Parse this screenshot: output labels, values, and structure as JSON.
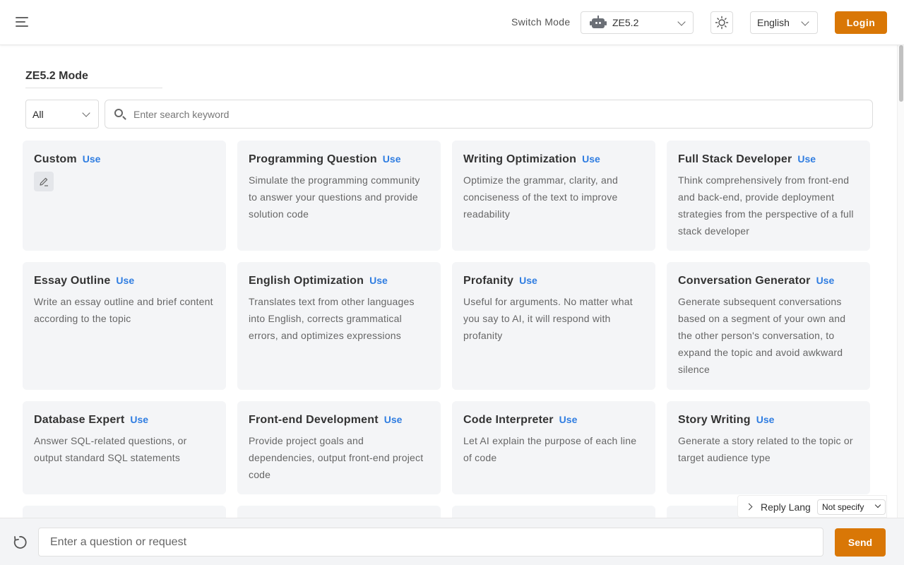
{
  "header": {
    "switch_mode_label": "Switch Mode",
    "mode_value": "ZE5.2",
    "language_value": "English",
    "login_label": "Login",
    "accent_color": "#d97706"
  },
  "main": {
    "title": "ZE5.2 Mode",
    "filter_value": "All",
    "search_placeholder": "Enter search keyword"
  },
  "cards": [
    {
      "title": "Custom",
      "use": "Use",
      "desc": "",
      "icon": "edit-icon"
    },
    {
      "title": "Programming Question",
      "use": "Use",
      "desc": "Simulate the programming community to answer your questions and provide solution code"
    },
    {
      "title": "Writing Optimization",
      "use": "Use",
      "desc": "Optimize the grammar, clarity, and conciseness of the text to improve readability"
    },
    {
      "title": "Full Stack Developer",
      "use": "Use",
      "desc": "Think comprehensively from front-end and back-end, provide deployment strategies from the perspective of a full stack developer"
    },
    {
      "title": "Essay Outline",
      "use": "Use",
      "desc": "Write an essay outline and brief content according to the topic"
    },
    {
      "title": "English Optimization",
      "use": "Use",
      "desc": "Translates text from other languages into English, corrects grammatical errors, and optimizes expressions"
    },
    {
      "title": "Profanity",
      "use": "Use",
      "desc": "Useful for arguments. No matter what you say to AI, it will respond with profanity"
    },
    {
      "title": "Conversation Generator",
      "use": "Use",
      "desc": "Generate subsequent conversations based on a segment of your own and the other person's conversation, to expand the topic and avoid awkward silence"
    },
    {
      "title": "Database Expert",
      "use": "Use",
      "desc": "Answer SQL-related questions, or output standard SQL statements"
    },
    {
      "title": "Front-end Development",
      "use": "Use",
      "desc": "Provide project goals and dependencies, output front-end project code"
    },
    {
      "title": "Code Interpreter",
      "use": "Use",
      "desc": "Let AI explain the purpose of each line of code"
    },
    {
      "title": "Story Writing",
      "use": "Use",
      "desc": "Generate a story related to the topic or target audience type"
    }
  ],
  "reply_lang": {
    "label": "Reply Lang",
    "value": "Not specify"
  },
  "composer": {
    "placeholder": "Enter a question or request",
    "send_label": "Send"
  }
}
